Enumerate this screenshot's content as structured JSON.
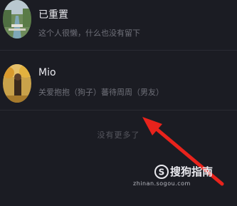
{
  "contacts": [
    {
      "name": "已重置",
      "signature": "这个人很懒，什么也没有留下",
      "avatar_icon": "avatar-canal-photo"
    },
    {
      "name": "Mio",
      "signature": "关爱抱抱（狗子）蕃待周周（男友）",
      "avatar_icon": "avatar-autumn-photo"
    }
  ],
  "list_footer": {
    "no_more_text": "没有更多了"
  },
  "annotation": {
    "icon": "red-arrow-icon",
    "color": "#e8231c"
  },
  "watermark": {
    "brand": "搜狗指南",
    "url": "zhinan.sogou.com",
    "icon": "sogou-logo-icon"
  }
}
